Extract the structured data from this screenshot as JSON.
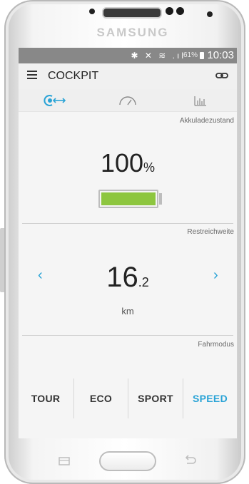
{
  "device": {
    "brand": "SAMSUNG"
  },
  "statusbar": {
    "icons": "✱ ✕ ≋ .ıl",
    "battery": "61%",
    "time": "10:03"
  },
  "appbar": {
    "title": "COCKPIT"
  },
  "tabs": [
    {
      "icon": "assist-connect-icon",
      "active": true
    },
    {
      "icon": "speedometer-icon",
      "active": false
    },
    {
      "icon": "bar-chart-icon",
      "active": false
    }
  ],
  "battery_section": {
    "label": "Akkuladezustand",
    "value": "100",
    "unit": "%",
    "level": 1.0
  },
  "range_section": {
    "label": "Restreichweite",
    "value_int": "16",
    "value_dec": ".2",
    "unit": "km",
    "prev": "‹",
    "next": "›"
  },
  "mode_section": {
    "label": "Fahrmodus",
    "modes": [
      {
        "label": "TOUR",
        "active": false
      },
      {
        "label": "ECO",
        "active": false
      },
      {
        "label": "SPORT",
        "active": false
      },
      {
        "label": "SPEED",
        "active": true
      }
    ]
  },
  "colors": {
    "accent": "#29a3d6",
    "battery_fill": "#8dc63f",
    "statusbar": "#888888"
  }
}
